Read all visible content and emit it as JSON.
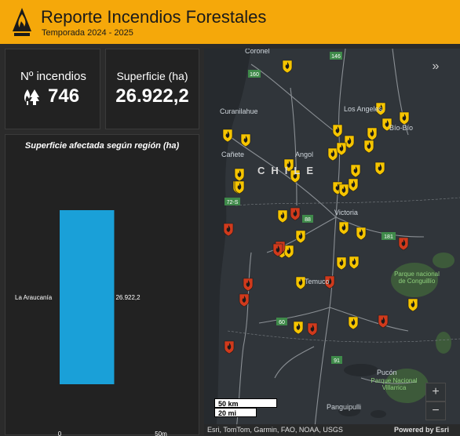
{
  "header": {
    "title": "Reporte Incendios Forestales",
    "subtitle": "Temporada 2024 - 2025"
  },
  "colors": {
    "header_bg": "#f5a80a",
    "bar": "#1aa0d8",
    "marker_active": "#f5c400",
    "marker_red": "#d03a1c"
  },
  "kpis": {
    "incendios_label": "Nº incendios",
    "incendios_value": "746",
    "superficie_label": "Superficie (ha)",
    "superficie_value": "26.922,2"
  },
  "chart_data": {
    "type": "bar",
    "orientation": "horizontal",
    "title": "Superficie afectada según región (ha)",
    "categories": [
      "La Araucanía"
    ],
    "values": [
      26922.2
    ],
    "value_labels": [
      "26.922,2"
    ],
    "xlim": [
      0,
      50000
    ],
    "xticks": [
      "0",
      "50m"
    ]
  },
  "map": {
    "labels": {
      "coronel": "Coronel",
      "los_angeles": "Los Angeles",
      "curanilahue": "Curanilahue",
      "biobio": "Bío-Bío",
      "canete": "Cañete",
      "angol": "Angol",
      "chile": "CHILE",
      "victoria": "Victoria",
      "temuco": "Temuco",
      "pucon": "Pucón",
      "panguipulli": "Panguipulli",
      "park1": "Parque nacional de Conguillío",
      "park2": "Parque Nacional Villarrica"
    },
    "roads": [
      "146",
      "160",
      "72-S",
      "88",
      "181",
      "60",
      "91"
    ],
    "scale_km": "50 km",
    "scale_mi": "20 mi",
    "attribution": "Esri, TomTom, Garmin, FAO, NOAA, USGS",
    "powered": "Powered by Esri",
    "zoom_in": "+",
    "zoom_out": "−",
    "collapse": "»"
  }
}
